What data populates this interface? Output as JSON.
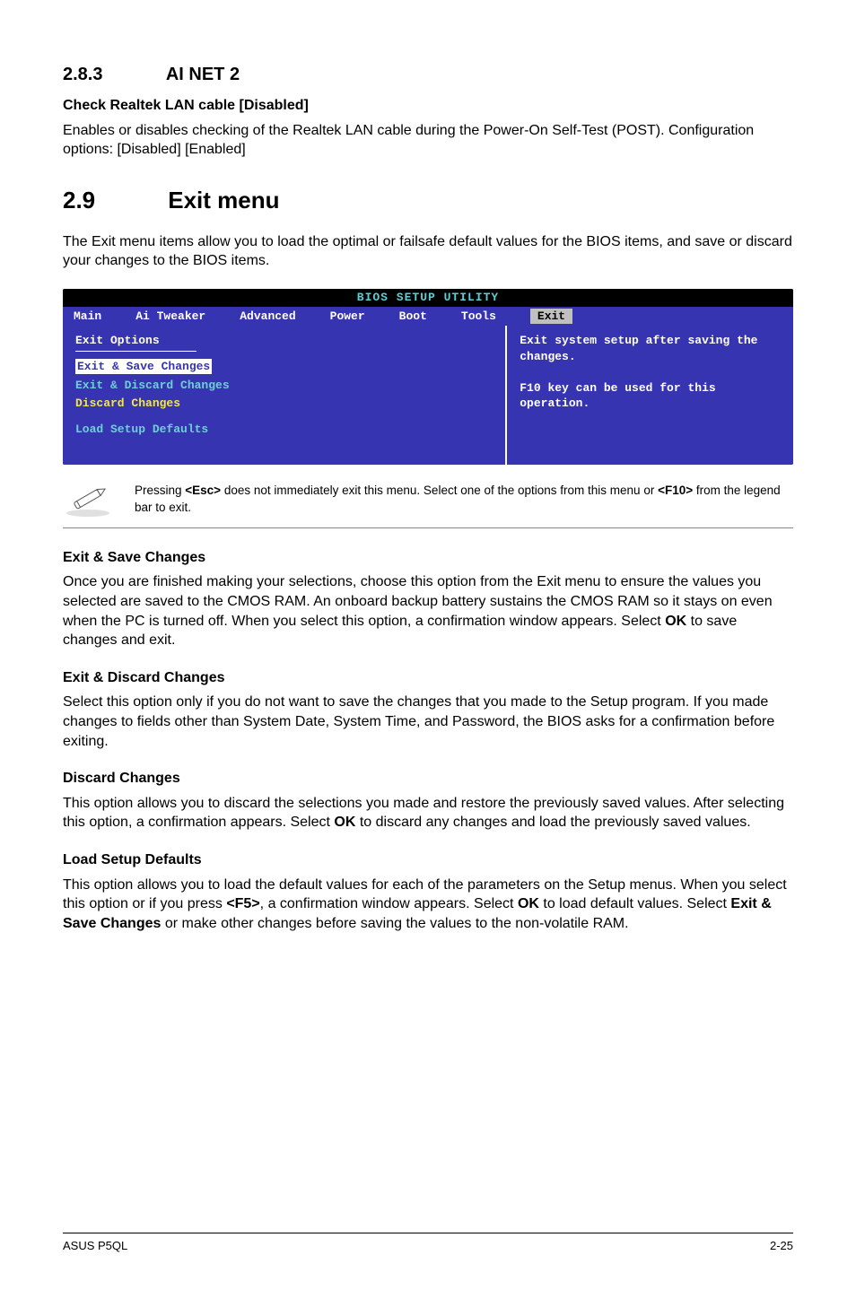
{
  "sec283": {
    "number": "2.8.3",
    "title": "AI NET 2"
  },
  "realtek": {
    "heading": "Check Realtek LAN cable [Disabled]",
    "body": "Enables or disables checking of the Realtek LAN cable during the Power-On Self-Test (POST). Configuration options: [Disabled] [Enabled]"
  },
  "sec29": {
    "number": "2.9",
    "title": "Exit menu"
  },
  "intro29": "The Exit menu items allow you to load the optimal or failsafe default values for the BIOS items, and save or discard your changes to the BIOS items.",
  "bios": {
    "title": "BIOS SETUP UTILITY",
    "menu": [
      "Main",
      "Ai Tweaker",
      "Advanced",
      "Power",
      "Boot",
      "Tools",
      "Exit"
    ],
    "left_heading": "Exit Options",
    "items": {
      "save": "Exit & Save Changes",
      "discard_exit": "Exit & Discard Changes",
      "discard": "Discard Changes",
      "load": "Load Setup Defaults"
    },
    "help": "Exit system setup after saving the changes.\n\nF10 key can be used for this operation."
  },
  "note": {
    "pre": "Pressing ",
    "key1": "<Esc>",
    "mid": " does not immediately exit this menu. Select one of the options from this menu or ",
    "key2": "<F10>",
    "post": " from the legend bar to exit."
  },
  "exit_save": {
    "heading": "Exit & Save Changes",
    "body_a": "Once you are finished making your selections, choose this option from the Exit menu to ensure the values you selected are saved to the CMOS RAM. An onboard backup battery sustains the CMOS RAM so it stays on even when the PC is turned off. When you select this option, a confirmation window appears. Select ",
    "ok": "OK",
    "body_b": " to save changes and exit."
  },
  "exit_discard": {
    "heading": "Exit & Discard Changes",
    "body": "Select this option only if you do not want to save the changes that you made to the Setup program. If you made changes to fields other than System Date, System Time, and Password, the BIOS asks for a confirmation before exiting."
  },
  "discard": {
    "heading": "Discard Changes",
    "body_a": "This option allows you to discard the selections you made and restore the previously saved values. After selecting this option, a confirmation appears. Select ",
    "ok": "OK",
    "body_b": " to discard any changes and load the previously saved values."
  },
  "load": {
    "heading": "Load Setup Defaults",
    "body_a": "This option allows you to load the default values for each of the parameters on the Setup menus. When you select this option or if you press ",
    "f5": "<F5>",
    "body_b": ", a confirmation window appears. Select ",
    "ok": "OK",
    "body_c": " to load default values. Select ",
    "esc_label": "Exit & Save Changes",
    "body_d": " or make other changes before saving the values to the non-volatile RAM."
  },
  "footer": {
    "left": "ASUS P5QL",
    "right": "2-25"
  }
}
